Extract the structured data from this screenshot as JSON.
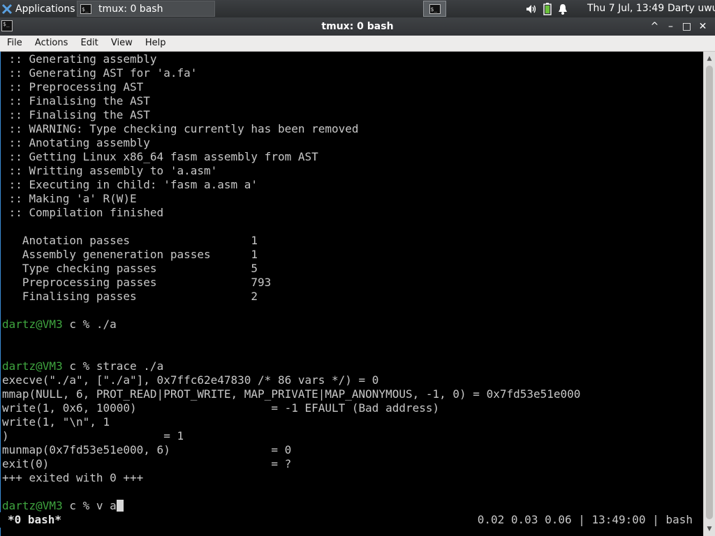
{
  "panel": {
    "apps_label": "Applications",
    "task_label": "tmux: 0 bash",
    "task_icon_text": "$_",
    "pager_icon_text": "$_",
    "clock": "Thu  7 Jul, 13:49",
    "user": "Darty uwu",
    "icons": [
      "volume-icon",
      "battery-icon",
      "bell-icon"
    ]
  },
  "window": {
    "title": "tmux: 0 bash",
    "icon_text": "$_",
    "controls": [
      "^",
      "–",
      "□",
      "✕"
    ]
  },
  "menubar": {
    "items": [
      "File",
      "Actions",
      "Edit",
      "View",
      "Help"
    ]
  },
  "terminal": {
    "lines": [
      " :: Generating assembly",
      " :: Generating AST for 'a.fa'",
      " :: Preprocessing AST",
      " :: Finalising the AST",
      " :: Finalising the AST",
      " :: WARNING: Type checking currently has been removed",
      " :: Anotating assembly",
      " :: Getting Linux x86_64 fasm assembly from AST",
      " :: Writting assembly to 'a.asm'",
      " :: Executing in child: 'fasm a.asm a'",
      " :: Making 'a' R(W)E",
      " :: Compilation finished",
      "",
      "   Anotation passes                  1",
      "   Assembly geneneration passes      1",
      "   Type checking passes              5",
      "   Preprocessing passes              793",
      "   Finalising passes                 2",
      "",
      "",
      "",
      "",
      "",
      "execve(\"./a\", [\"./a\"], 0x7ffc62e47830 /* 86 vars */) = 0",
      "mmap(NULL, 6, PROT_READ|PROT_WRITE, MAP_PRIVATE|MAP_ANONYMOUS, -1, 0) = 0x7fd53e51e000",
      "write(1, 0x6, 10000)                    = -1 EFAULT (Bad address)",
      "write(1, \"\\n\", 1",
      ")                       = 1",
      "munmap(0x7fd53e51e000, 6)               = 0",
      "exit(0)                                 = ?",
      "+++ exited with 0 +++",
      "",
      ""
    ],
    "prompt1_user": "dartz@VM3",
    "prompt1_cmd": " c % ./a",
    "prompt2_user": "dartz@VM3",
    "prompt2_cmd": " c % strace ./a",
    "prompt3_user": "dartz@VM3",
    "prompt3_cmd": " c % v a"
  },
  "status": {
    "window": "*0 bash*",
    "right": "0.02 0.03 0.06 | 13:49:00 | bash"
  }
}
